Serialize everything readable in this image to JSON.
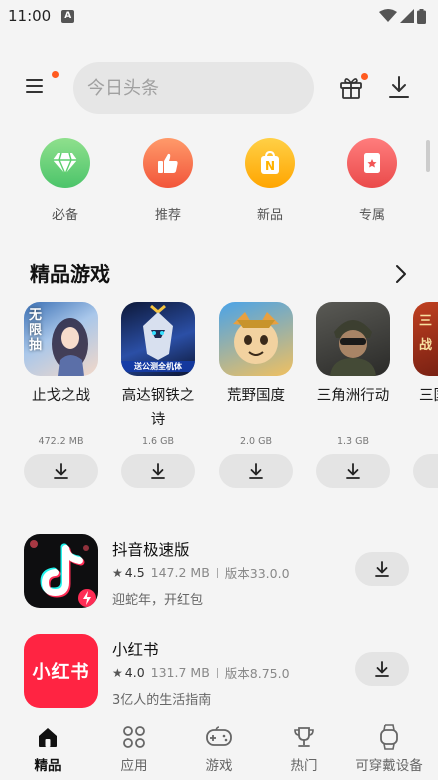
{
  "status": {
    "time": "11:00",
    "indicator": "A"
  },
  "header": {
    "search_placeholder": "今日头条",
    "menu_icon": "menu-icon",
    "gift_icon": "gift-icon",
    "download_icon": "download-icon",
    "badge_color": "#ff5a1f"
  },
  "categories": [
    {
      "label": "必备",
      "icon": "diamond-icon",
      "color": "#5ccf6e"
    },
    {
      "label": "推荐",
      "icon": "thumbs-up-icon",
      "color": "#ff6f4e"
    },
    {
      "label": "新品",
      "icon": "new-bag-icon",
      "color": "#ffb300"
    },
    {
      "label": "专属",
      "icon": "star-card-icon",
      "color": "#f25555"
    }
  ],
  "featured_games": {
    "title": "精品游戏",
    "items": [
      {
        "name": "止戈之战",
        "size": "472.2 MB",
        "icon_text": "无限抽"
      },
      {
        "name": "高达钢铁之诗",
        "size": "1.6 GB",
        "icon_text": "送公测全机体"
      },
      {
        "name": "荒野国度",
        "size": "2.0 GB",
        "icon_text": ""
      },
      {
        "name": "三角洲行动",
        "size": "1.3 GB",
        "icon_text": ""
      },
      {
        "name": "三国",
        "size": "",
        "icon_text": "三战"
      }
    ]
  },
  "apps": [
    {
      "name": "抖音极速版",
      "rating": "4.5",
      "size": "147.2 MB",
      "version": "版本33.0.0",
      "desc": "迎蛇年，开红包"
    },
    {
      "name": "小红书",
      "rating": "4.0",
      "size": "131.7 MB",
      "version": "版本8.75.0",
      "desc": "3亿人的生活指南",
      "icon_text": "小红书"
    }
  ],
  "bottom_nav": [
    {
      "label": "精品",
      "icon": "home-icon",
      "active": true
    },
    {
      "label": "应用",
      "icon": "apps-grid-icon",
      "active": false
    },
    {
      "label": "游戏",
      "icon": "gamepad-icon",
      "active": false
    },
    {
      "label": "热门",
      "icon": "trophy-icon",
      "active": false
    },
    {
      "label": "可穿戴设备",
      "icon": "watch-icon",
      "active": false
    }
  ]
}
